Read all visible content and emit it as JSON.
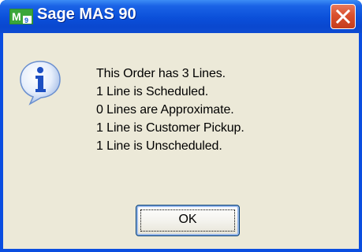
{
  "window": {
    "title": "Sage MAS 90"
  },
  "dialog": {
    "icon": "information-icon",
    "lines": [
      "This Order has 3 Lines.",
      "1 Line is Scheduled.",
      "0 Lines are Approximate.",
      "1 Line is Customer Pickup.",
      "1 Line is Unscheduled."
    ],
    "ok_label": "OK"
  },
  "colors": {
    "titlebar": "#0a48cf",
    "client_background": "#ece9d8",
    "close_button": "#d9502e"
  }
}
